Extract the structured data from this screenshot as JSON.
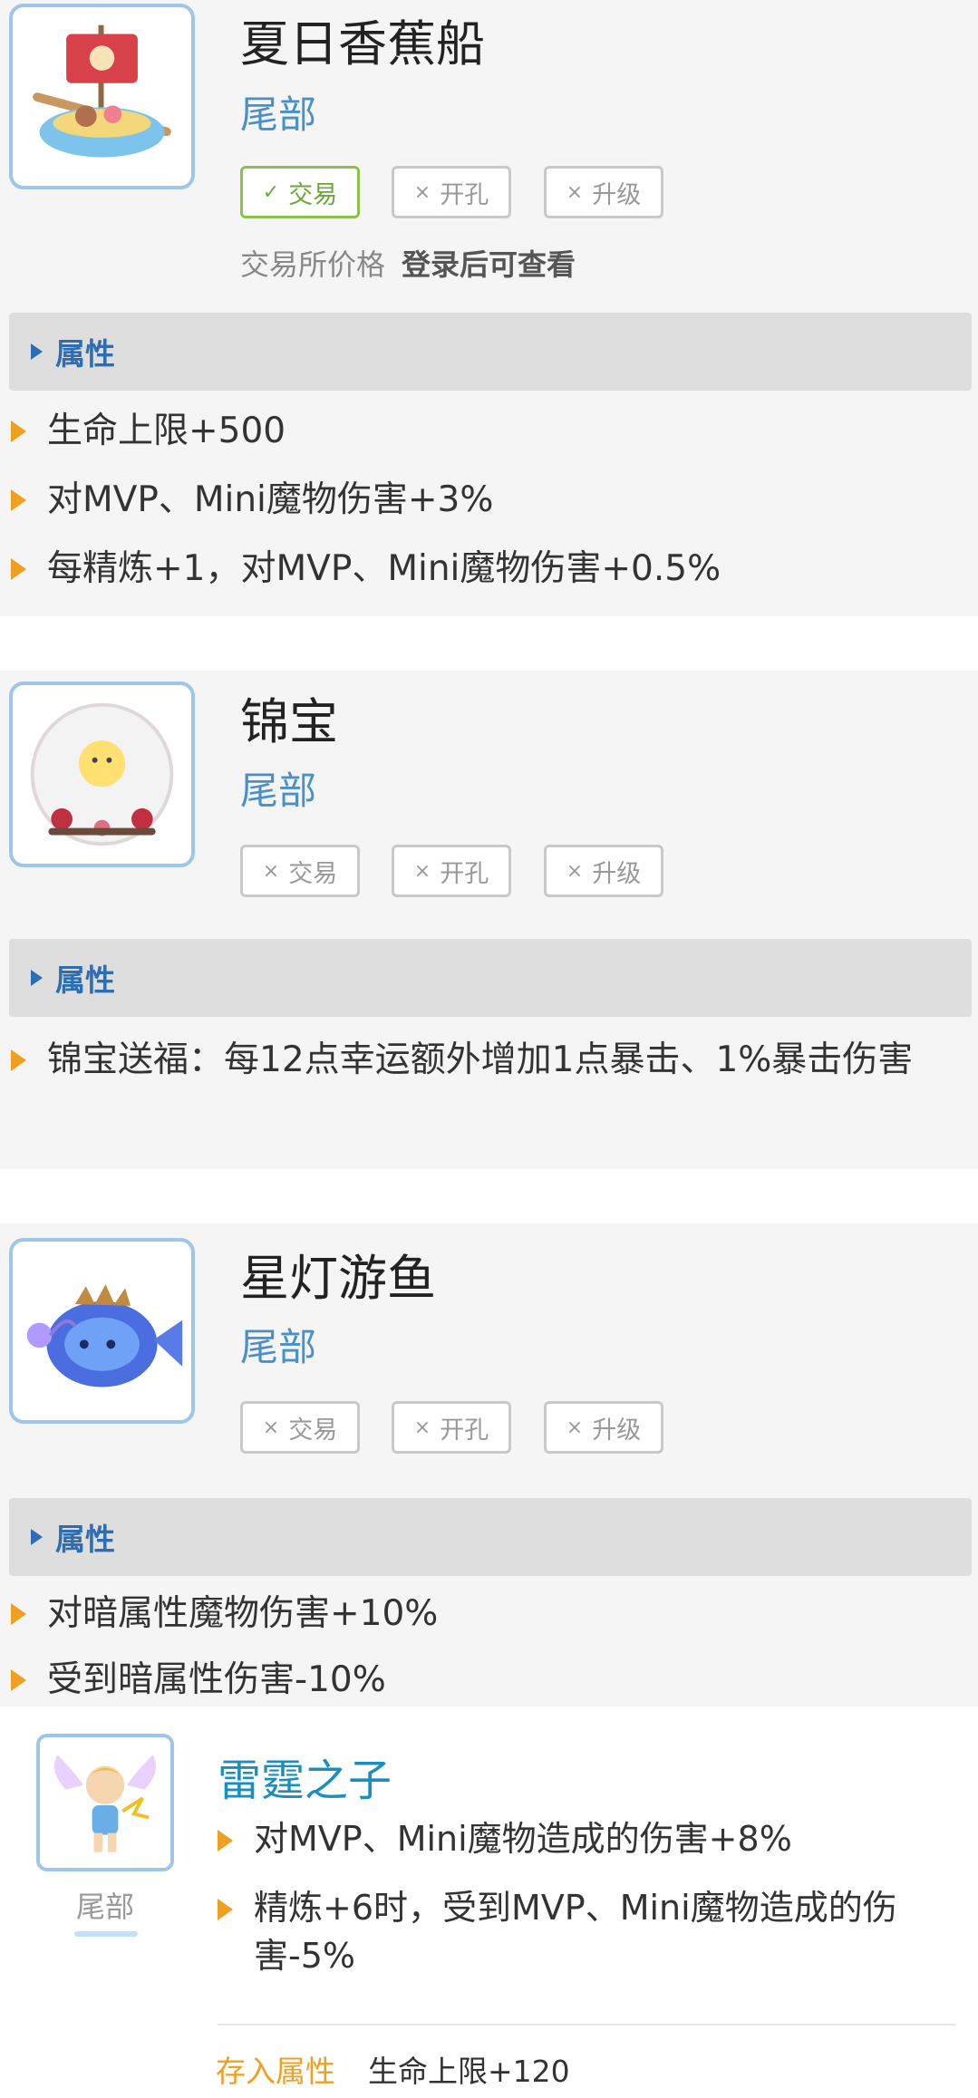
{
  "labels": {
    "attr_header": "属性"
  },
  "items": [
    {
      "name": "夏日香蕉船",
      "slot": "尾部",
      "tags": [
        {
          "label": "交易",
          "enabled": true
        },
        {
          "label": "开孔",
          "enabled": false
        },
        {
          "label": "升级",
          "enabled": false
        }
      ],
      "price_label": "交易所价格",
      "price_value": "登录后可查看",
      "attributes": [
        "生命上限+500",
        "对MVP、Mini魔物伤害+3%",
        "每精炼+1，对MVP、Mini魔物伤害+0.5%"
      ]
    },
    {
      "name": "锦宝",
      "slot": "尾部",
      "tags": [
        {
          "label": "交易",
          "enabled": false
        },
        {
          "label": "开孔",
          "enabled": false
        },
        {
          "label": "升级",
          "enabled": false
        }
      ],
      "attributes": [
        "锦宝送福：每12点幸运额外增加1点暴击、1%暴击伤害"
      ]
    },
    {
      "name": "星灯游鱼",
      "slot": "尾部",
      "tags": [
        {
          "label": "交易",
          "enabled": false
        },
        {
          "label": "开孔",
          "enabled": false
        },
        {
          "label": "升级",
          "enabled": false
        }
      ],
      "attributes": [
        "对暗属性魔物伤害+10%",
        "受到暗属性伤害-10%"
      ]
    }
  ],
  "bottom": {
    "name": "雷霆之子",
    "slot": "尾部",
    "attributes": [
      "对MVP、Mini魔物造成的伤害+8%",
      "精炼+6时，受到MVP、Mini魔物造成的伤害-5%"
    ],
    "store_label": "存入属性",
    "store_value": "生命上限+120"
  },
  "marks": {
    "check": "✓",
    "cross": "×"
  },
  "colors": {
    "slot_blue": "#4a90c8",
    "header_blue": "#2c6db4",
    "arrow_orange": "#f0a020",
    "tag_green": "#6aa83a",
    "title_cyan": "#1a8fbf"
  }
}
